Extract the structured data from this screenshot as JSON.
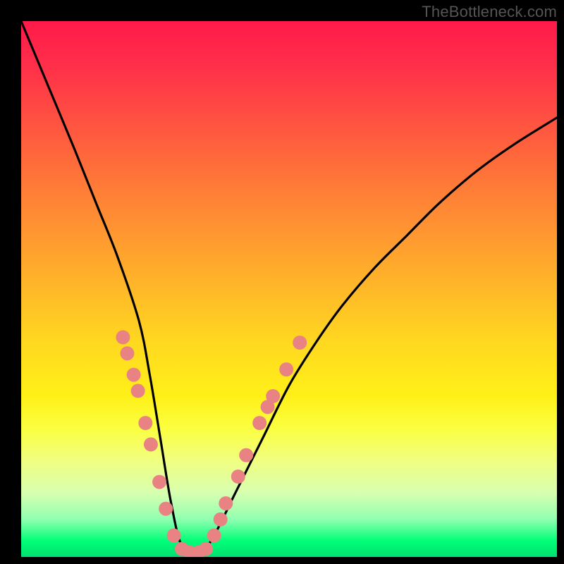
{
  "watermark": "TheBottleneck.com",
  "chart_data": {
    "type": "line",
    "title": "",
    "xlabel": "",
    "ylabel": "",
    "xlim": [
      0,
      100
    ],
    "ylim": [
      0,
      100
    ],
    "gradient_stops": [
      {
        "pos": 0,
        "color": "#ff1a4a"
      },
      {
        "pos": 20,
        "color": "#ff5640"
      },
      {
        "pos": 40,
        "color": "#ff9830"
      },
      {
        "pos": 60,
        "color": "#ffd820"
      },
      {
        "pos": 80,
        "color": "#f0ff80"
      },
      {
        "pos": 95,
        "color": "#40ff90"
      },
      {
        "pos": 100,
        "color": "#00e070"
      }
    ],
    "series": [
      {
        "name": "bottleneck-curve",
        "x": [
          0,
          5,
          10,
          14,
          18,
          22,
          24,
          26,
          28,
          30,
          33,
          36,
          40,
          45,
          50,
          55,
          60,
          66,
          72,
          78,
          85,
          92,
          100
        ],
        "y": [
          100,
          88,
          76,
          66,
          56,
          44,
          34,
          22,
          10,
          2,
          0,
          4,
          12,
          22,
          32,
          40,
          47,
          54,
          60,
          66,
          72,
          77,
          82
        ]
      }
    ],
    "markers": {
      "name": "highlight-dots",
      "color": "#e98383",
      "radius": 10,
      "points": [
        {
          "x": 19.0,
          "y": 41
        },
        {
          "x": 19.8,
          "y": 38
        },
        {
          "x": 21.0,
          "y": 34
        },
        {
          "x": 21.8,
          "y": 31
        },
        {
          "x": 23.2,
          "y": 25
        },
        {
          "x": 24.2,
          "y": 21
        },
        {
          "x": 25.8,
          "y": 14
        },
        {
          "x": 27.0,
          "y": 9
        },
        {
          "x": 28.5,
          "y": 4
        },
        {
          "x": 30.0,
          "y": 1.5
        },
        {
          "x": 31.5,
          "y": 0.8
        },
        {
          "x": 33.0,
          "y": 0.8
        },
        {
          "x": 34.5,
          "y": 1.5
        },
        {
          "x": 36.0,
          "y": 4
        },
        {
          "x": 37.2,
          "y": 7
        },
        {
          "x": 38.2,
          "y": 10
        },
        {
          "x": 40.5,
          "y": 15
        },
        {
          "x": 42.0,
          "y": 19
        },
        {
          "x": 44.5,
          "y": 25
        },
        {
          "x": 46.0,
          "y": 28
        },
        {
          "x": 47.0,
          "y": 30
        },
        {
          "x": 49.5,
          "y": 35
        },
        {
          "x": 52.0,
          "y": 40
        }
      ]
    }
  }
}
